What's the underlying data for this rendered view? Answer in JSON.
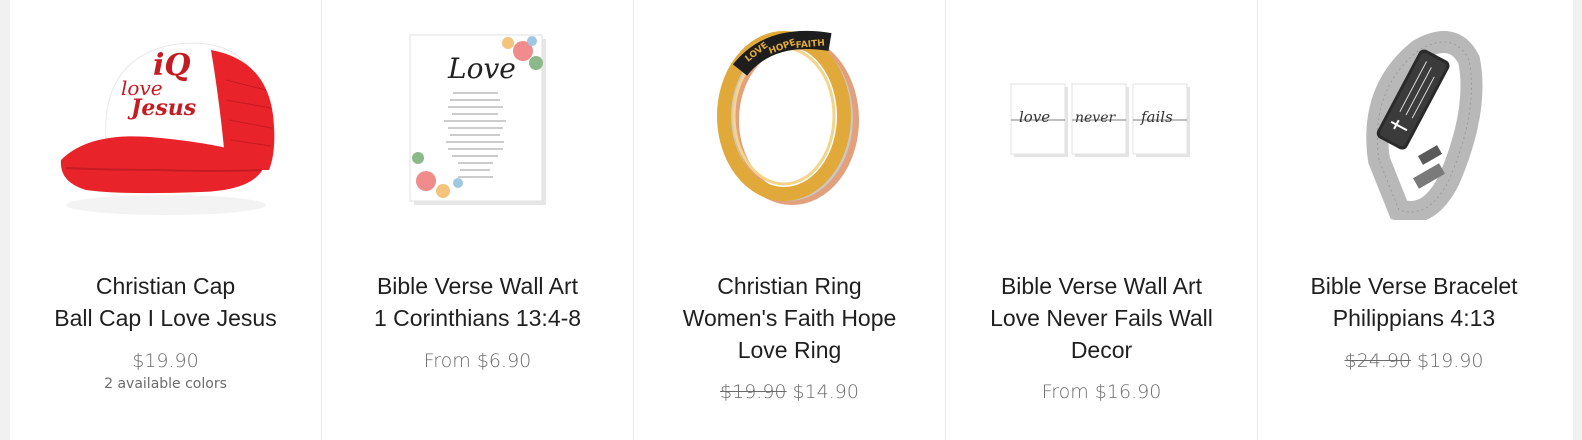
{
  "products": [
    {
      "title_line1": "Christian Cap",
      "title_line2": "Ball Cap I Love Jesus",
      "title_line3": "",
      "price": "$19.90",
      "compare_price": "",
      "variants_note": "2 available colors",
      "image_text": "I Love Jesus",
      "image_icon": "cap-icon"
    },
    {
      "title_line1": "Bible Verse Wall Art",
      "title_line2": "1 Corinthians 13:4-8",
      "title_line3": "",
      "price": "From $6.90",
      "compare_price": "",
      "variants_note": "",
      "image_text": "Love",
      "image_icon": "wall-art-icon"
    },
    {
      "title_line1": "Christian Ring",
      "title_line2": "Women's Faith Hope",
      "title_line3": "Love Ring",
      "price": "$14.90",
      "compare_price": "$19.90",
      "variants_note": "",
      "image_text": [
        "LOVE",
        "HOPE",
        "FAITH"
      ],
      "image_icon": "ring-icon"
    },
    {
      "title_line1": "Bible Verse Wall Art",
      "title_line2": "Love Never Fails Wall",
      "title_line3": "Decor",
      "price": "From $16.90",
      "compare_price": "",
      "variants_note": "",
      "image_text": [
        "love",
        "never",
        "fails"
      ],
      "image_icon": "wall-art-set-icon"
    },
    {
      "title_line1": "Bible Verse Bracelet",
      "title_line2": "Philippians 4:13",
      "title_line3": "",
      "price": "$19.90",
      "compare_price": "$24.90",
      "variants_note": "",
      "image_text": "",
      "image_icon": "bracelet-icon"
    }
  ],
  "colors": {
    "cap_red": "#e8232a",
    "title_text": "#1f1f1f",
    "price_text": "#6b6b6b",
    "ring_gold": "#e0a93a",
    "ring_silver": "#c8c8c8",
    "ring_rose": "#e2a07c",
    "bracelet_black": "#2a2a2a"
  }
}
